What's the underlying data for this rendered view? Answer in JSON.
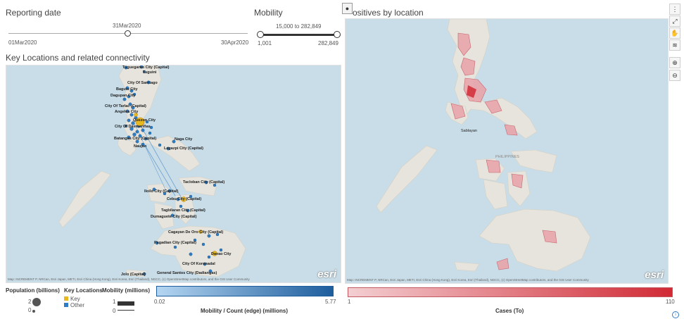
{
  "reporting": {
    "title": "Reporting date",
    "current": "31Mar2020",
    "min": "01Mar2020",
    "max": "30Apr2020",
    "position": 0.5
  },
  "mobility": {
    "title": "Mobility",
    "range": "15,000 to 282,849",
    "min": "1,001",
    "max": "282,849"
  },
  "left_map": {
    "title": "Key Locations and related connectivity",
    "cities": [
      "Tuguegarao City (Capital)",
      "Tuguini",
      "City Of Santiago",
      "Baguio City",
      "Dagupan City",
      "City Of Tarlac (Capital)",
      "Angeles City",
      "Quezon City",
      "City Of Dasmariñas",
      "Batangas City (Capital)",
      "Naujan",
      "Naga City",
      "Legazpi City (Capital)",
      "Tacloban City (Capital)",
      "Iloilo City (Capital)",
      "Cebu City (Capital)",
      "Tagbilaran City (Capital)",
      "Dumaguete City (Capital)",
      "Cagayan De Oro City (Capital)",
      "Pagadian City (Capital)",
      "Davao City",
      "City Of Koronadal",
      "General Santos City (Dadiangas)",
      "Jolo (Capital)"
    ],
    "attribution": "Map: INCREMENT P, NRCan, Esri Japan, METI, Esri China (Hong Kong), Esri Korea, Esri (Thailand), NGCC, (c) OpenStreetMap contributors, and the GIS User Community",
    "esri": "esri"
  },
  "right_map": {
    "title": "ositives by location",
    "labels": [
      "Sablayan",
      "PHILIPPINES"
    ],
    "attribution": "Map: INCREMENT P, NRCan, Esri Japan, METI, Esri China (Hong Kong), Esri Korea, Esri (Thailand), NGCC, (c) OpenStreetMap contributors, and the GIS User Community",
    "esri": "esri"
  },
  "toolbar": {
    "more": "⋮",
    "expand": "⤢",
    "pan": "✋",
    "layers": "≋",
    "zoom_in": "⊕",
    "zoom_out": "⊖"
  },
  "legend_left": {
    "population_title": "Population (billions)",
    "population_values": [
      "2",
      "0"
    ],
    "key_title": "Key Locations",
    "key_items": [
      "Key",
      "Other"
    ],
    "mobility_title": "Mobility (millions)",
    "mobility_values": [
      "1",
      "0"
    ],
    "gradient_min": "0.02",
    "gradient_max": "5.77",
    "gradient_label": "Mobility / Count (edge) (millions)"
  },
  "legend_right": {
    "min": "1",
    "max": "110",
    "label": "Cases (To)"
  },
  "colors": {
    "key": "#e8b820",
    "other": "#2f7dc4",
    "gradient_start": "#b5d6f2",
    "gradient_end": "#1d5d9d",
    "cases_start": "#f3cfd2",
    "cases_end": "#d12a35"
  }
}
